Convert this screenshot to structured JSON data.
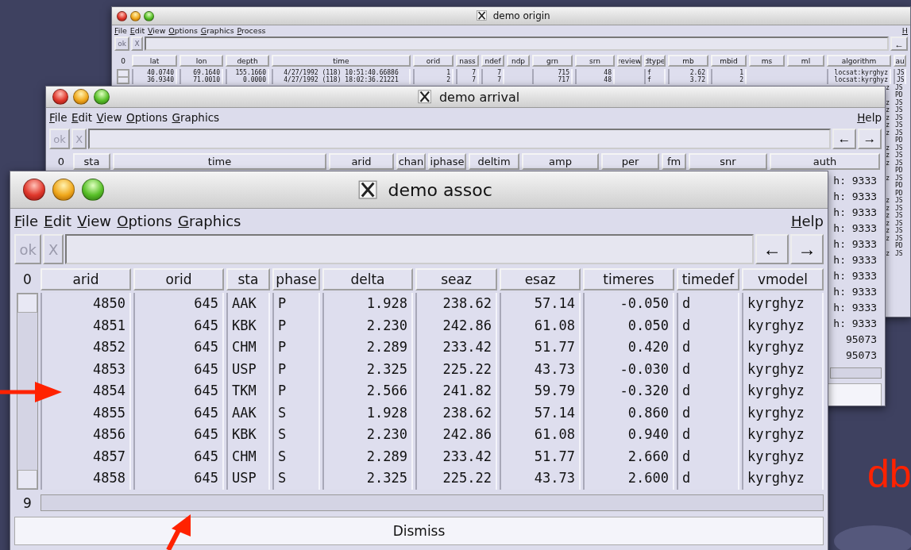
{
  "windows": [
    {
      "title": "demo origin",
      "menu": [
        {
          "label": "File"
        },
        {
          "label": "Edit"
        },
        {
          "label": "View"
        },
        {
          "label": "Options"
        },
        {
          "label": "Graphics"
        },
        {
          "label": "Process"
        }
      ],
      "help_menu": "H",
      "toolbar": {
        "buttons": [
          {
            "label": "ok",
            "disabled": true
          },
          {
            "label": "X",
            "disabled": true
          }
        ],
        "arrows": [
          "←"
        ]
      },
      "row_count": "0",
      "columns": [
        "lat",
        "lon",
        "depth",
        "time",
        "orid",
        "nass",
        "ndef",
        "ndp",
        "grn",
        "srn",
        "review",
        "dtype",
        "mb",
        "mbid",
        "ms",
        "ml",
        "algorithm",
        "au"
      ],
      "rows": [
        [
          "40.0740",
          "69.1640",
          "155.1660",
          "4/27/1992 (118) 10:51:40.66886",
          "1",
          "7",
          "7",
          null,
          "715",
          "48",
          null,
          "f",
          "2.62",
          "1",
          null,
          null,
          "locsat:kyrghyz",
          "JS"
        ],
        [
          "36.9340",
          "71.0010",
          "0.0000",
          "4/27/1992 (118) 18:02:36.21221",
          "2",
          "7",
          "7",
          null,
          "717",
          "48",
          null,
          "f",
          "3.72",
          "2",
          null,
          null,
          "locsat:kyrghyz",
          "JS"
        ],
        [
          "z",
          "JS"
        ],
        [
          null,
          "PD"
        ],
        [
          "z",
          "JS"
        ],
        [
          "z",
          "JS"
        ],
        [
          "z",
          "JS"
        ],
        [
          "z",
          "JS"
        ],
        [
          "z",
          "JS"
        ],
        [
          null,
          "PD"
        ],
        [
          "z",
          "JS"
        ],
        [
          "z",
          "JS"
        ],
        [
          "z",
          "JS"
        ],
        [
          null,
          "PD"
        ],
        [
          "z",
          "JS"
        ],
        [
          null,
          "PD"
        ],
        [
          null,
          "PD"
        ],
        [
          "z",
          "JS"
        ],
        [
          "z",
          "JS"
        ],
        [
          "z",
          "JS"
        ],
        [
          "z",
          "JS"
        ],
        [
          "z",
          "JS"
        ],
        [
          "z",
          "JS"
        ],
        [
          null,
          "PD"
        ],
        [
          "z",
          "JS"
        ]
      ]
    },
    {
      "title": "demo arrival",
      "menu": [
        {
          "label": "File"
        },
        {
          "label": "Edit"
        },
        {
          "label": "View"
        },
        {
          "label": "Options"
        },
        {
          "label": "Graphics"
        }
      ],
      "help_menu": "Help",
      "toolbar": {
        "buttons": [
          {
            "label": "ok",
            "disabled": true
          },
          {
            "label": "X",
            "disabled": true
          }
        ],
        "arrows": [
          "←",
          "→"
        ]
      },
      "row_count": "0",
      "columns": [
        "sta",
        "time",
        "arid",
        "chan",
        "iphase",
        "deltim",
        "amp",
        "per",
        "fm",
        "snr",
        "auth"
      ],
      "rows": [
        [
          "h: 9333"
        ],
        [
          "h: 9333"
        ],
        [
          "h: 9333"
        ],
        [
          "h: 9333"
        ],
        [
          "h: 9333"
        ],
        [
          "h: 9333"
        ],
        [
          "h: 9333"
        ],
        [
          "h: 9333"
        ],
        [
          "h: 9333"
        ],
        [
          "h: 9333"
        ],
        [
          "95073"
        ],
        [
          "95073"
        ]
      ]
    },
    {
      "title": "demo assoc",
      "menu": [
        {
          "label": "File"
        },
        {
          "label": "Edit"
        },
        {
          "label": "View"
        },
        {
          "label": "Options"
        },
        {
          "label": "Graphics"
        }
      ],
      "help_menu": "Help",
      "toolbar": {
        "buttons": [
          {
            "label": "ok",
            "disabled": true
          },
          {
            "label": "X",
            "disabled": true
          }
        ],
        "arrows": [
          "←",
          "→"
        ]
      },
      "row_count": "0",
      "columns": [
        "arid",
        "orid",
        "sta",
        "phase",
        "delta",
        "seaz",
        "esaz",
        "timeres",
        "timedef",
        "vmodel"
      ],
      "rows": [
        [
          "4850",
          "645",
          "AAK",
          "P",
          "1.928",
          "238.62",
          "57.14",
          "-0.050",
          "d",
          "kyrghyz"
        ],
        [
          "4851",
          "645",
          "KBK",
          "P",
          "2.230",
          "242.86",
          "61.08",
          "0.050",
          "d",
          "kyrghyz"
        ],
        [
          "4852",
          "645",
          "CHM",
          "P",
          "2.289",
          "233.42",
          "51.77",
          "0.420",
          "d",
          "kyrghyz"
        ],
        [
          "4853",
          "645",
          "USP",
          "P",
          "2.325",
          "225.22",
          "43.73",
          "-0.030",
          "d",
          "kyrghyz"
        ],
        [
          "4854",
          "645",
          "TKM",
          "P",
          "2.566",
          "241.82",
          "59.79",
          "-0.320",
          "d",
          "kyrghyz"
        ],
        [
          "4855",
          "645",
          "AAK",
          "S",
          "1.928",
          "238.62",
          "57.14",
          "0.860",
          "d",
          "kyrghyz"
        ],
        [
          "4856",
          "645",
          "KBK",
          "S",
          "2.230",
          "242.86",
          "61.08",
          "0.940",
          "d",
          "kyrghyz"
        ],
        [
          "4857",
          "645",
          "CHM",
          "S",
          "2.289",
          "233.42",
          "51.77",
          "2.660",
          "d",
          "kyrghyz"
        ],
        [
          "4858",
          "645",
          "USP",
          "S",
          "2.325",
          "225.22",
          "43.73",
          "2.600",
          "d",
          "kyrghyz"
        ]
      ],
      "footer_count": "9",
      "dismiss": "Dismiss"
    }
  ],
  "slide_label": "db"
}
